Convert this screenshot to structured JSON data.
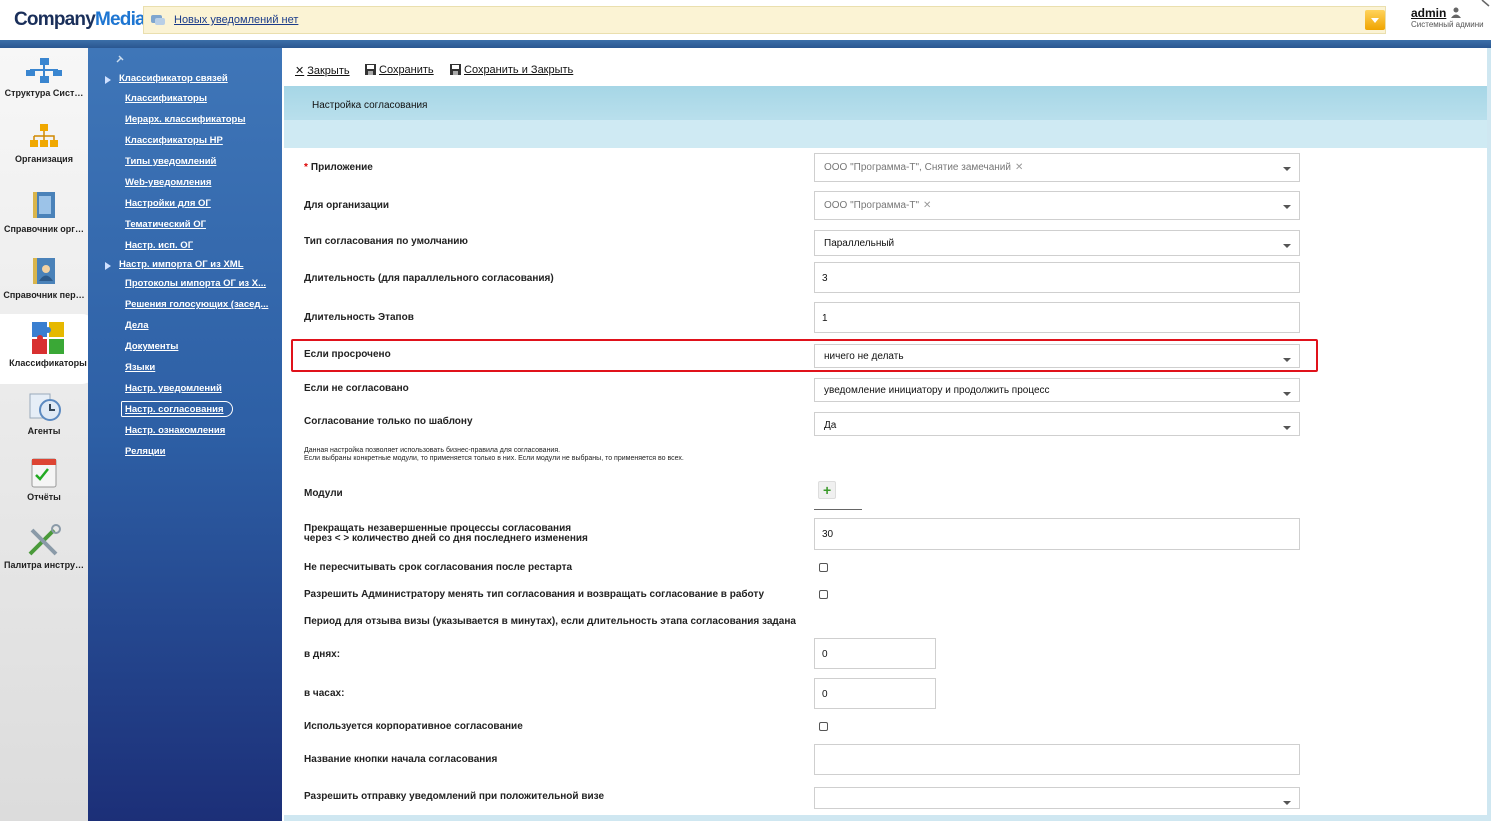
{
  "header": {
    "logo_part1": "Company",
    "logo_part2": "Media",
    "notification_text": "Новых уведомлений нет",
    "user_name": "admin",
    "user_role": "Системный админи"
  },
  "apps": [
    {
      "label": "Структура Сист…",
      "icon": "structure-icon"
    },
    {
      "label": "Организация",
      "icon": "organization-icon"
    },
    {
      "label": "Справочник орг…",
      "icon": "org-directory-icon"
    },
    {
      "label": "Справочник пер…",
      "icon": "person-directory-icon"
    },
    {
      "label": "Классификаторы",
      "icon": "puzzle-icon"
    },
    {
      "label": "Агенты",
      "icon": "agents-icon"
    },
    {
      "label": "Отчёты",
      "icon": "reports-icon"
    },
    {
      "label": "Палитра инстру…",
      "icon": "tools-icon"
    }
  ],
  "nav": [
    "Классификатор связей",
    "Классификаторы",
    "Иерарх. классификаторы",
    "Классификаторы HP",
    "Типы уведомлений",
    "Web-уведомления",
    "Настройки для ОГ",
    "Тематический ОГ",
    "Настр. исп. ОГ",
    "Настр. импорта ОГ из XML",
    "Протоколы импорта ОГ из X...",
    "Решения голосующих (засед...",
    "Дела",
    "Документы",
    "Языки",
    "Настр. уведомлений",
    "Настр. согласования",
    "Настр. ознакомления",
    "Реляции"
  ],
  "toolbar": {
    "close": "Закрыть",
    "save": "Сохранить",
    "save_close": "Сохранить и Закрыть"
  },
  "section_title": "Настройка согласования",
  "form": {
    "app_label": "Приложение",
    "app_value": "ООО \"Программа-Т\", Снятие замечаний",
    "org_label": "Для организации",
    "org_value": "ООО \"Программа-Т\"",
    "type_label": "Тип согласования по умолчанию",
    "type_value": "Параллельный",
    "duration_label": "Длительность (для параллельного согласования)",
    "duration_value": "3",
    "stage_label": "Длительность Этапов",
    "stage_value": "1",
    "overdue_label": "Если просрочено",
    "overdue_value": "ничего не делать",
    "notagreed_label": "Если не согласовано",
    "notagreed_value": "уведомление инициатору и продолжить процесс",
    "template_label": "Согласование только по шаблону",
    "template_value": "Да",
    "note_line1": "Данная настройка позволяет использовать бизнес-правила для согласования.",
    "note_line2": "Если выбраны конкретные модули, то применяется только в них. Если модули не выбраны, то применяется во всех.",
    "modules_label": "Модули",
    "stop_label_1": "Прекращать незавершенные процессы согласования",
    "stop_label_2": "через < > количество дней со дня последнего изменения",
    "stop_value": "30",
    "norecalc_label": "Не пересчитывать срок согласования после рестарта",
    "allowadmin_label": "Разрешить Администратору менять тип согласования и возвращать согласование в работу",
    "period_label": "Период для отзыва визы (указывается в минутах), если длительность этапа согласования задана",
    "days_label": "в днях:",
    "days_value": "0",
    "hours_label": "в часах:",
    "hours_value": "0",
    "corp_label": "Используется корпоративное согласование",
    "button_name_label": "Название кнопки начала согласования",
    "button_name_value": "",
    "notify_label": "Разрешить отправку уведомлений при положительной визе",
    "notify_value": ""
  }
}
